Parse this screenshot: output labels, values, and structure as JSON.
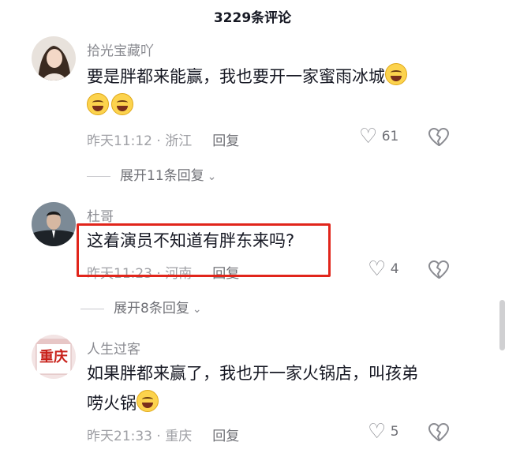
{
  "header": {
    "title": "3229条评论"
  },
  "comments": [
    {
      "username": "拾光宝藏吖",
      "text": "要是胖都来能赢，我也要开一家蜜雨冰城",
      "time": "昨天11:12",
      "location": "浙江",
      "reply_label": "回复",
      "likes": "61",
      "expand": "展开11条回复"
    },
    {
      "username": "杜哥",
      "text": "这着演员不知道有胖东来吗?",
      "time": "昨天11:23",
      "location": "河南",
      "reply_label": "回复",
      "likes": "4",
      "expand": "展开8条回复"
    },
    {
      "username": "人生过客",
      "text": "如果胖都来赢了，我也开一家火锅店，叫孩弟",
      "text_line2": "唠火锅",
      "avatar_text": "重庆",
      "time": "昨天21:33",
      "location": "重庆",
      "reply_label": "回复",
      "likes": "5"
    }
  ],
  "separator": " · ",
  "icons": {
    "like": "heart-outline-icon",
    "dislike": "broken-heart-outline-icon",
    "expand": "chevron-down-icon",
    "emoji": "laugh-sweat-emoji"
  },
  "colors": {
    "highlight": "#e1251b",
    "secondary_text": "#9fa0a5"
  }
}
